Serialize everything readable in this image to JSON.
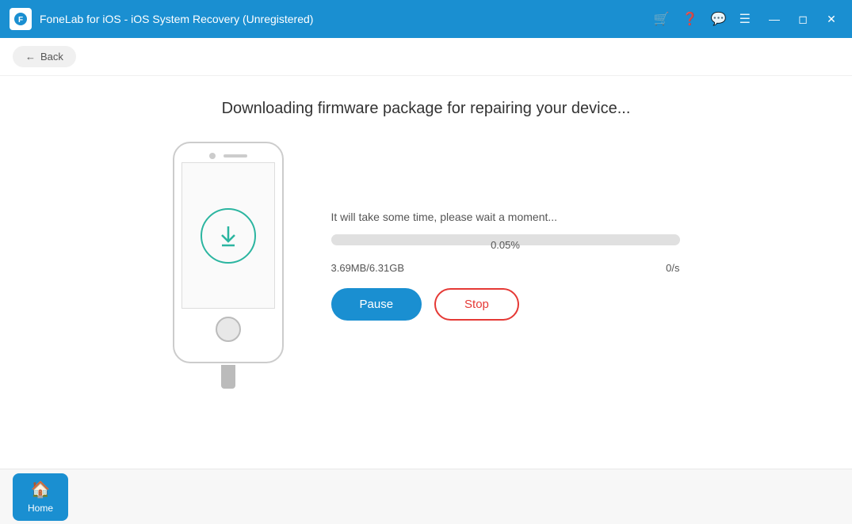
{
  "titlebar": {
    "title": "FoneLab for iOS - iOS System Recovery (Unregistered)",
    "icons": [
      "cart-icon",
      "question-icon",
      "chat-icon",
      "menu-icon"
    ],
    "controls": [
      "minimize-icon",
      "maximize-icon",
      "close-icon"
    ]
  },
  "nav": {
    "back_label": "Back"
  },
  "main": {
    "page_title": "Downloading firmware package for repairing your device...",
    "wait_message": "It will take some time, please wait a moment...",
    "progress_percent": 0.05,
    "progress_label": "0.05%",
    "downloaded_size": "3.69MB/6.31GB",
    "speed": "0/s",
    "pause_label": "Pause",
    "stop_label": "Stop"
  },
  "bottom": {
    "home_label": "Home"
  }
}
